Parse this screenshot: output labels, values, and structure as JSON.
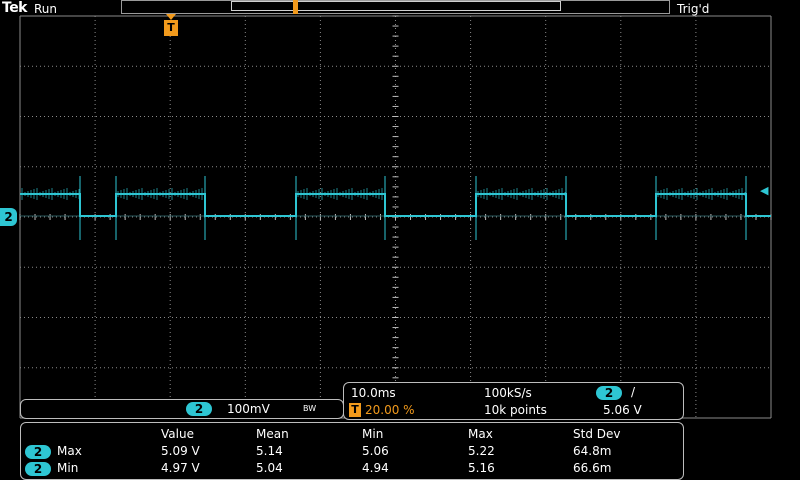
{
  "header": {
    "brand": "Tek",
    "run_state": "Run",
    "trigger_status": "Trig'd"
  },
  "colors": {
    "channel2": "#2ec6d3",
    "trigger": "#f29a1c",
    "grid": "#8a8a8a",
    "panel_border": "#bdbdbd"
  },
  "markers": {
    "channel_tag": "2",
    "trigger_tag": "T"
  },
  "channel_panel": {
    "channel": "2",
    "scale": "100mV",
    "bw_symbol": "BW"
  },
  "timebase": {
    "time_per_div": "10.0ms",
    "sample_rate": "100kS/s",
    "trigger_channel": "2",
    "trigger_slope": "/",
    "trigger_position": "20.00 %",
    "record_length": "10k points",
    "trigger_level": "5.06 V"
  },
  "measurements": {
    "headers": [
      "Value",
      "Mean",
      "Min",
      "Max",
      "Std Dev"
    ],
    "rows": [
      {
        "channel": "2",
        "name": "Max",
        "values": [
          "5.09 V",
          "5.14",
          "5.06",
          "5.22",
          "64.8m"
        ]
      },
      {
        "channel": "2",
        "name": "Min",
        "values": [
          "4.97 V",
          "5.04",
          "4.94",
          "5.16",
          "66.6m"
        ]
      }
    ]
  }
}
